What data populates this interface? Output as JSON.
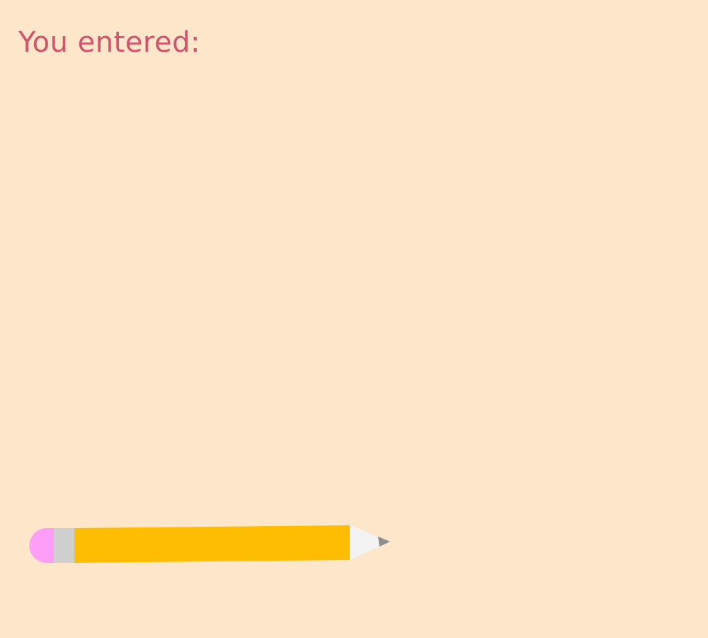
{
  "page": {
    "title": "You entered:",
    "entered_text": ""
  },
  "colors": {
    "background": "#FDE6C9",
    "title": "#D1536C",
    "pencil_eraser": "#FF9EF6",
    "pencil_ferrule": "#CFCFCF",
    "pencil_body": "#FFBD00",
    "pencil_wood": "#F3F3F3",
    "pencil_lead": "#8E8E8E"
  },
  "icons": {
    "pencil": "pencil-icon"
  }
}
